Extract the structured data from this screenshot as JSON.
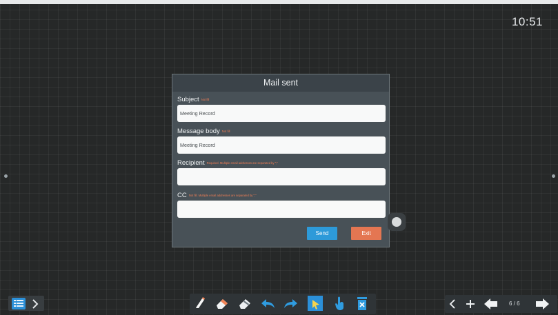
{
  "status": {
    "time": "10:51"
  },
  "dialog": {
    "title": "Mail sent",
    "subject": {
      "label": "Subject",
      "note": "Not fill",
      "value": "Meeting Record"
    },
    "message_body": {
      "label": "Message body",
      "note": "Not fill",
      "value": "Meeting Record"
    },
    "recipient": {
      "label": "Recipient",
      "note": "Required. Multiple email addresses are separated by \";\"",
      "value": ""
    },
    "cc": {
      "label": "CC",
      "note": "Not fill. Multiple email addresses are separated by \";\"",
      "value": ""
    },
    "send_label": "Send",
    "exit_label": "Exit",
    "colors": {
      "send": "#2d9ad9",
      "exit": "#e47652",
      "note": "#f07e55"
    }
  },
  "toolbar": {
    "center_tools": [
      "pen-icon",
      "eraser-icon",
      "clear-eraser-icon",
      "undo-icon",
      "redo-icon",
      "select-icon",
      "hand-icon",
      "delete-icon"
    ],
    "page_indicator": "6 / 6"
  }
}
